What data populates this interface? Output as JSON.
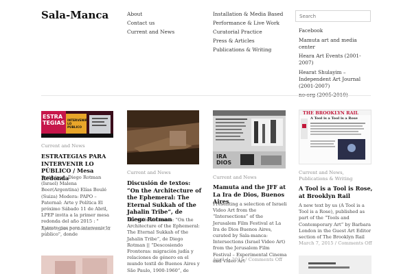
{
  "site": {
    "title": "Sala-Manca"
  },
  "menu_primary": [
    "About",
    "Contact us",
    "Current and News"
  ],
  "menu_secondary": [
    "Installation & Media Based",
    "Performance & Live Work",
    "Curatorial Practice",
    "Press & Articles",
    "Publications & Writing"
  ],
  "search": {
    "placeholder": "Search"
  },
  "external_links": [
    "Facebook",
    "Mamuta art and media center",
    "Heara Art Events (2001-2007)",
    "Hearat Shulayim – Independent Art Journal (2001-2007)",
    "no-org (2005-2010)"
  ],
  "posts": [
    {
      "category": "Current and News",
      "title": "ESTRATEGIAS PARA INTERVENIR LO PÚBLICO / Mesa Redonda",
      "excerpt": "Participan: Diego Rotman (Israel) Malena Beer(Argentina) Elías Boulé (Suiza) Modera: PAPO – Paternal: Arte y Política El próximo Sábado 11 de Abril, LPEP invita a la primer mesa redonda del año 2015 : \" Estrategias para intervenir lo público\", donde",
      "date": "April 7, 2015",
      "comments": "Comments Off",
      "thumb_text": [
        "ESTRA",
        "TEGIAS",
        "INTERVENIR LO PÚBLICO"
      ]
    },
    {
      "category": "Current and News",
      "title": "Discusión de textos: “On the Architecture of the Ephemeral: The Eternal Sukkah of the Jahalin Tribe”, de Diego Rotman",
      "excerpt": "Discusión de textos: “On the Architecture of the Ephemeral: The Eternal Sukkah of the Jahalin Tribe”, de Diego Rotman || “Descosiendo Fronteras: migración judía y relaciones de género en el mundo textil de Buenos Aires y São Paulo, 1900-1960”, de",
      "date": "",
      "comments": ""
    },
    {
      "category": "Current and News",
      "title": "Mamuta and the JFF at La Ira de Dios, Buenos Aires",
      "excerpt": "Presenting a selection of Israeli Video Art from the “Intersections” of the Jerusalem Film Festival at La Ira de Dios Buenos Aires, curated by Sala-manca: Intersections (Israel Video Art) from the Jerusalem Film Festival – Experimental Cinema and Video Art",
      "date": "April 4, 2015",
      "comments": "Comments Off",
      "thumb_text": [
        "IRA",
        "DIOS"
      ]
    },
    {
      "category": "Current and News, Publications & Writing",
      "title": "A Tool is a Tool is Rose, at Brooklyn Rail",
      "excerpt": "A new text by us (A Tool is a Tool is a Rose), published as part of the “Tools and Contemporary Art” by Barbara London in the Guest Art Editor section of The Brooklyn Rail",
      "date": "March 7, 2015",
      "comments": "Comments Off",
      "thumb_text": [
        "THE BROOKLYN RAIL",
        "A Tool is a Tool is a Rose"
      ]
    }
  ],
  "separator": "/"
}
